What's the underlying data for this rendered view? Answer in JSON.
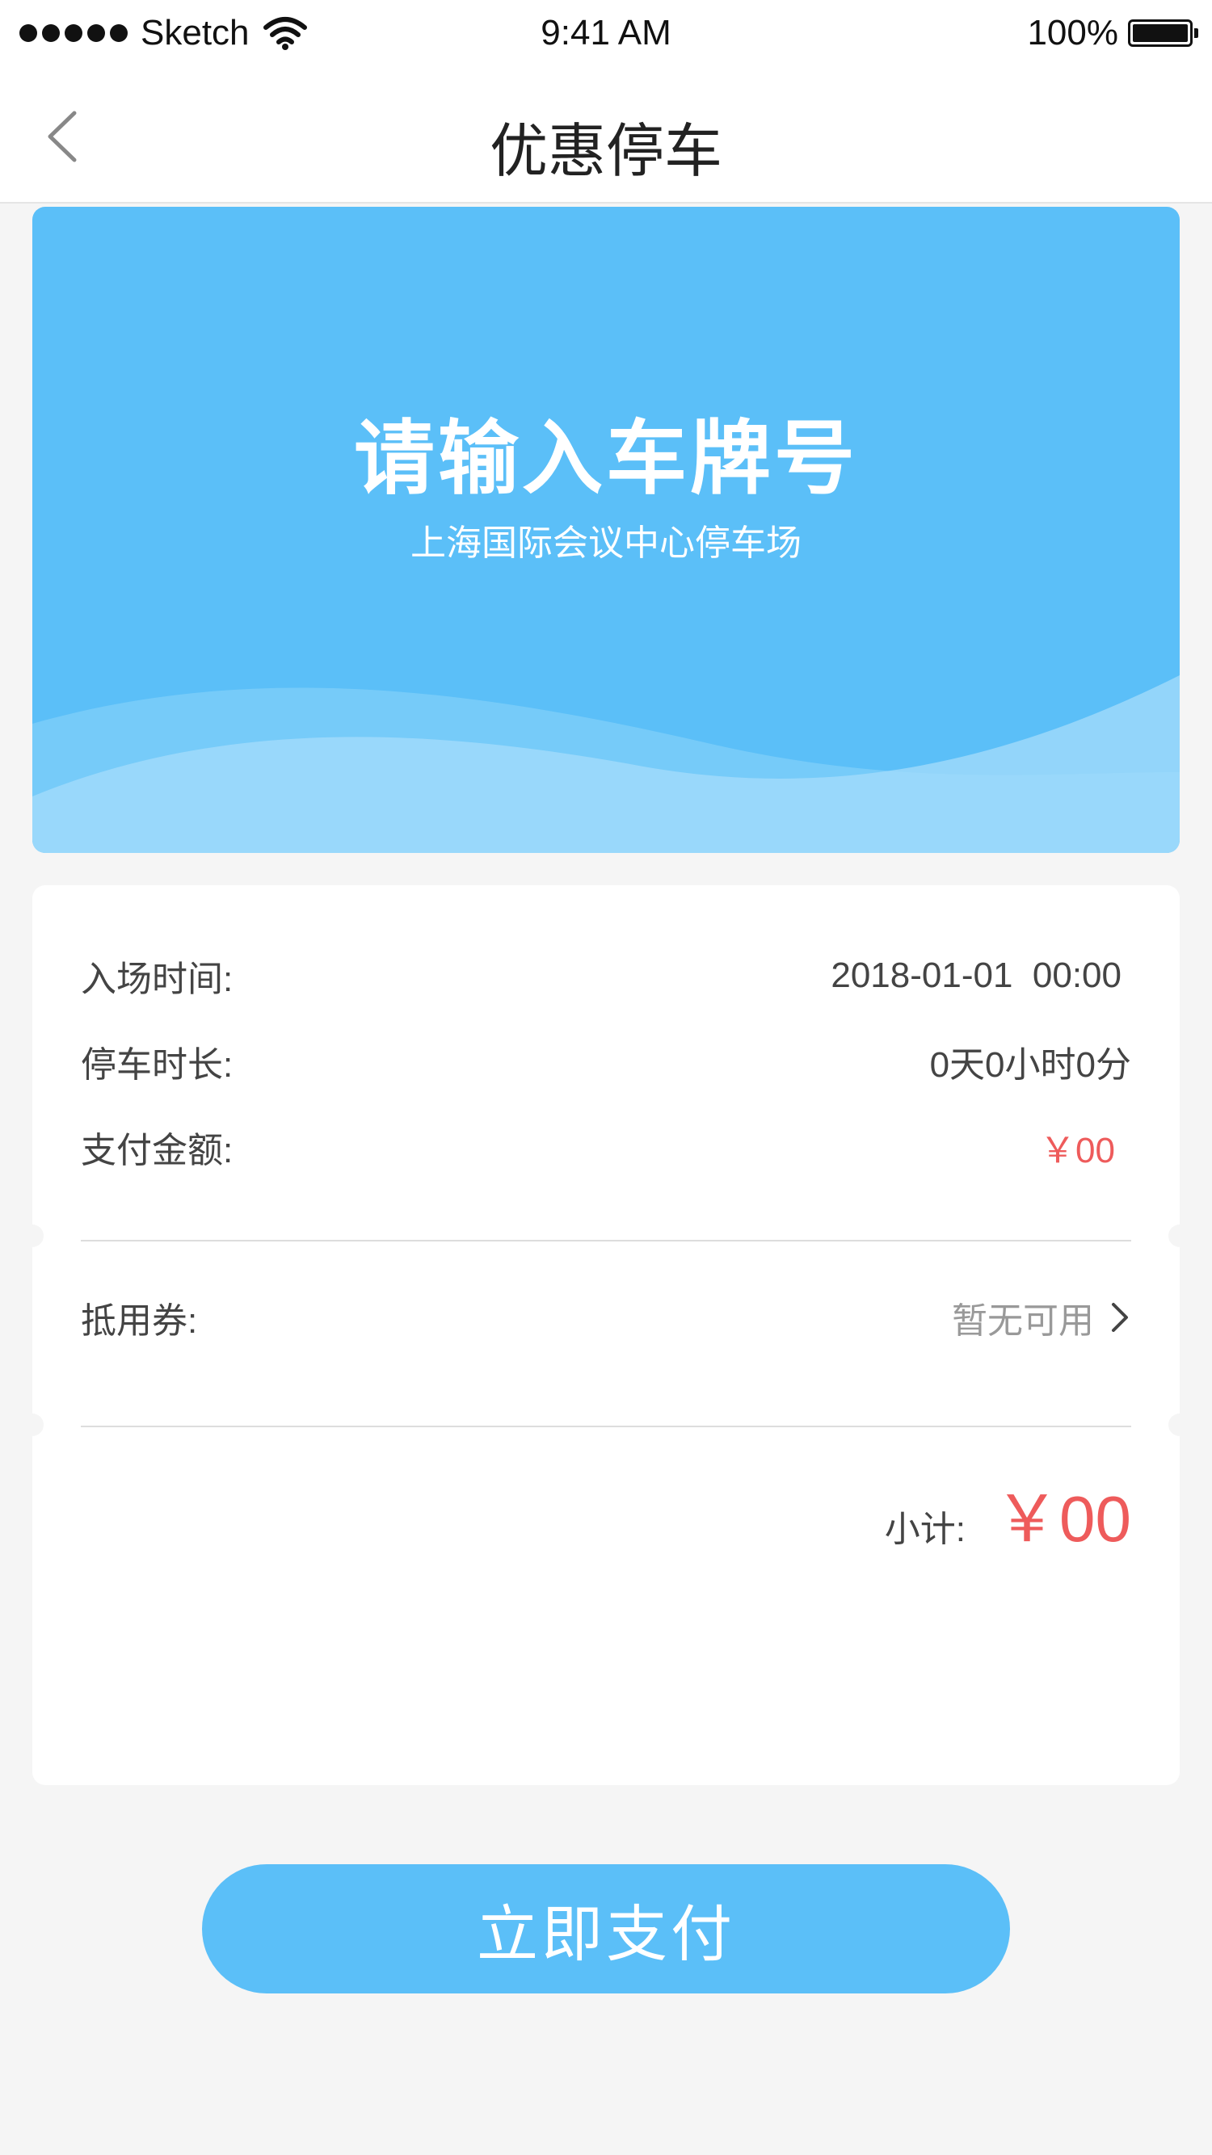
{
  "status_bar": {
    "carrier": "Sketch",
    "time": "9:41 AM",
    "battery_text": "100%"
  },
  "nav": {
    "title": "优惠停车",
    "back_icon": "chevron-left-icon"
  },
  "hero": {
    "title": "请输入车牌号",
    "subtitle": "上海国际会议中心停车场",
    "background_color": "#5bbff8"
  },
  "details": {
    "entry_time_label": "入场时间:",
    "entry_time_value": "2018-01-01  00:00",
    "duration_label": "停车时长:",
    "duration_value": "0天0小时0分",
    "amount_label": "支付金额:",
    "amount_value": "￥00",
    "coupon_label": "抵用券:",
    "coupon_value": "暂无可用",
    "subtotal_label": "小计:",
    "subtotal_value": "￥00"
  },
  "pay_button": {
    "label": "立即支付"
  },
  "colors": {
    "accent": "#5bbff8",
    "price_red": "#ee5b5b",
    "page_bg": "#f5f5f5"
  }
}
